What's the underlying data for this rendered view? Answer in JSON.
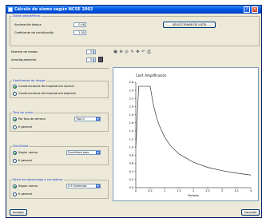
{
  "window": {
    "title": "Cálculo de sismo según NCSE 2002"
  },
  "geo_group": {
    "title": "Datos geográficos",
    "basic_accel": {
      "label": "Aceleración básica",
      "value": "0.06"
    },
    "contrib_coef": {
      "label": "Coeficiente de contribución",
      "value": "1.00"
    },
    "select_button": "SELECCIONAR DE LISTA"
  },
  "modes": {
    "label": "Número de modos",
    "value": "3"
  },
  "damping": {
    "label": "Amortiguamiento",
    "value": "5"
  },
  "damping_group": {
    "title": "Coeficiente de riesgo",
    "options": [
      "Construcciones de importancia normal",
      "Construcciones de importancia especial"
    ],
    "selected": 0
  },
  "soil_group": {
    "title": "Tipo de suelo",
    "opt1": "Por tipo de terreno",
    "opt2": "K general",
    "select_value": "Tipo II"
  },
  "ductility_group": {
    "title": "Ductilidad",
    "opt1": "Según norma",
    "opt2": "K general",
    "select_value": "Ductilidad baja"
  },
  "comb_group": {
    "title": "Parte de sobrecarga a considerar",
    "opt1": "Según norma",
    "opt2": "K general",
    "select_value": "0.5 Viviendas"
  },
  "buttons": {
    "accept": "Aceptar",
    "cancel": "Cancelar"
  },
  "icons": [
    "save-icon",
    "zoom-icon",
    "zoom-window-icon",
    "pencil-icon",
    "pan-icon",
    "undo-icon",
    "print-icon"
  ],
  "chart_data": {
    "type": "line",
    "title": "Coef. Amplificación",
    "xlabel": "Periodo",
    "ylim": [
      0,
      2.6
    ],
    "xlim": [
      0,
      4
    ],
    "yticks": [
      "2.6",
      "2.4",
      "2.2",
      "2.0",
      "1.8",
      "1.6",
      "1.4",
      "1.2",
      "1.0",
      "0.8",
      "0.6",
      "0.4",
      "0.2",
      "0.0"
    ],
    "xticks": [
      "0",
      "0.5",
      "1",
      "1.5",
      "2",
      "2.5",
      "3",
      "3.5",
      "4"
    ],
    "series": [
      {
        "x": [
          0,
          0.1,
          0.18,
          0.5,
          0.6,
          0.7,
          0.8,
          1.0,
          1.2,
          1.5,
          2.0,
          2.5,
          3.0,
          3.5,
          4.0
        ],
        "y": [
          1.0,
          2.5,
          2.5,
          2.5,
          2.08,
          1.79,
          1.56,
          1.25,
          1.04,
          0.83,
          0.63,
          0.5,
          0.42,
          0.36,
          0.31
        ]
      }
    ]
  }
}
